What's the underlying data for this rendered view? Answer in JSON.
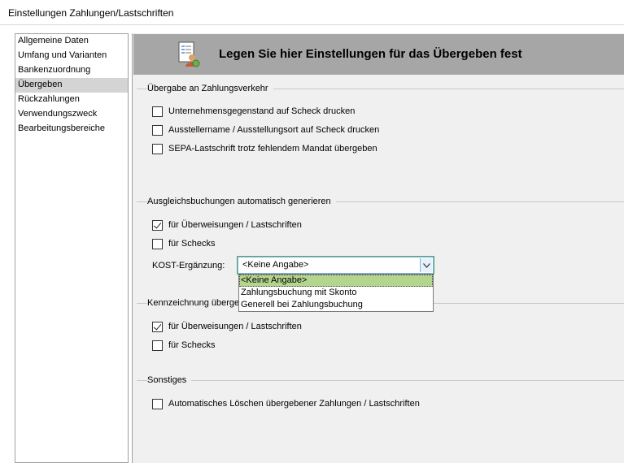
{
  "window": {
    "title": "Einstellungen Zahlungen/Lastschriften"
  },
  "nav": {
    "items": [
      {
        "label": "Allgemeine Daten"
      },
      {
        "label": "Umfang und Varianten"
      },
      {
        "label": "Bankenzuordnung"
      },
      {
        "label": "Übergeben"
      },
      {
        "label": "Rückzahlungen"
      },
      {
        "label": "Verwendungszweck"
      },
      {
        "label": "Bearbeitungsbereiche"
      }
    ],
    "selected": "Übergeben"
  },
  "banner": {
    "title": "Legen Sie hier Einstellungen für das Übergeben fest",
    "icon": "settings-document-icon"
  },
  "groups": {
    "zahlungsverkehr": {
      "title": "Übergabe an Zahlungsverkehr",
      "options": [
        {
          "label": "Unternehmensgegenstand auf Scheck drucken",
          "checked": false
        },
        {
          "label": "Ausstellername / Ausstellungsort auf Scheck drucken",
          "checked": false
        },
        {
          "label": "SEPA-Lastschrift trotz fehlendem Mandat übergeben",
          "checked": false
        }
      ]
    },
    "ausgleich": {
      "title": "Ausgleichsbuchungen  automatisch  generieren",
      "options": [
        {
          "label": "für Überweisungen / Lastschriften",
          "checked": true
        },
        {
          "label": "für Schecks",
          "checked": false
        }
      ],
      "kost": {
        "label": "KOST-Ergänzung:",
        "value": "<Keine Angabe>",
        "options": [
          "<Keine Angabe>",
          "Zahlungsbuchung mit Skonto",
          "Generell bei Zahlungsbuchung"
        ],
        "highlighted": "<Keine Angabe>"
      }
    },
    "kennzeichnung": {
      "title": "Kennzeichnung überge",
      "options": [
        {
          "label": "für Überweisungen / Lastschriften",
          "checked": true
        },
        {
          "label": "für Schecks",
          "checked": false
        }
      ]
    },
    "sonstiges": {
      "title": "Sonstiges",
      "options": [
        {
          "label": "Automatisches Löschen übergebener Zahlungen / Lastschriften",
          "checked": false
        }
      ]
    }
  },
  "colors": {
    "selected_nav": "#d4d4d4",
    "banner": "#a6a6a6",
    "highlight": "#b4d58e",
    "panel": "#f0f0f0"
  }
}
